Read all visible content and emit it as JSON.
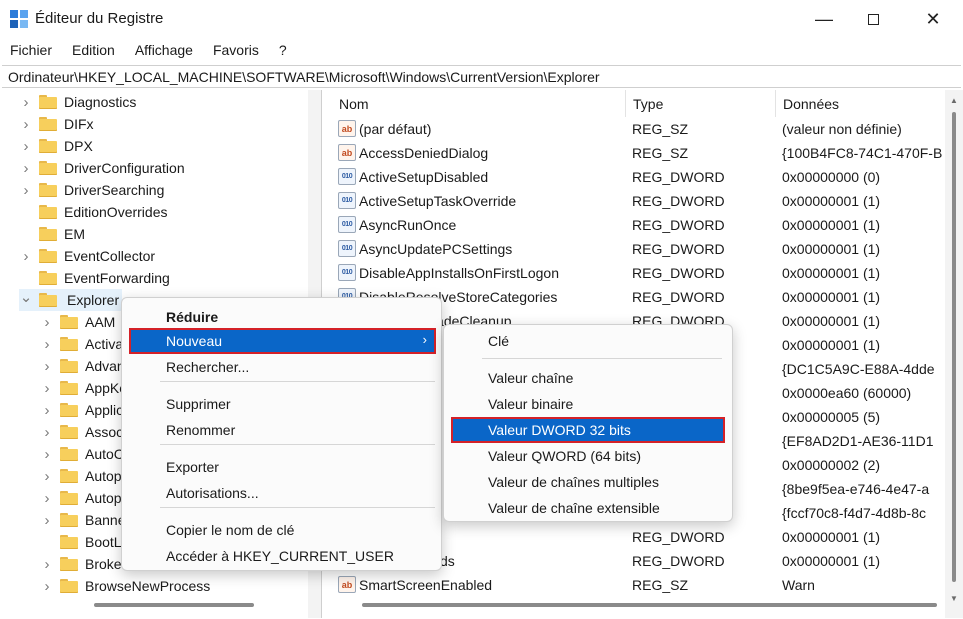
{
  "window": {
    "title": "Éditeur du Registre",
    "minimize_glyph": "—",
    "close_glyph": "✕"
  },
  "menubar": [
    "Fichier",
    "Edition",
    "Affichage",
    "Favoris",
    "?"
  ],
  "address": "Ordinateur\\HKEY_LOCAL_MACHINE\\SOFTWARE\\Microsoft\\Windows\\CurrentVersion\\Explorer",
  "tree": {
    "items": [
      {
        "label": "Diagnostics",
        "expandable": true
      },
      {
        "label": "DIFx",
        "expandable": true
      },
      {
        "label": "DPX",
        "expandable": true
      },
      {
        "label": "DriverConfiguration",
        "expandable": true
      },
      {
        "label": "DriverSearching",
        "expandable": true
      },
      {
        "label": "EditionOverrides",
        "expandable": false
      },
      {
        "label": "EM",
        "expandable": false
      },
      {
        "label": "EventCollector",
        "expandable": true
      },
      {
        "label": "EventForwarding",
        "expandable": false
      },
      {
        "label": "Explorer",
        "expandable": true,
        "expanded": true,
        "selected": true
      },
      {
        "label": "AAM",
        "expandable": true,
        "child": true
      },
      {
        "label": "Activa",
        "expandable": true,
        "child": true
      },
      {
        "label": "Advan",
        "expandable": true,
        "child": true
      },
      {
        "label": "AppKe",
        "expandable": true,
        "child": true
      },
      {
        "label": "Applic",
        "expandable": true,
        "child": true
      },
      {
        "label": "Associ",
        "expandable": true,
        "child": true
      },
      {
        "label": "AutoC",
        "expandable": true,
        "child": true
      },
      {
        "label": "Autop",
        "expandable": true,
        "child": true
      },
      {
        "label": "Autop",
        "expandable": true,
        "child": true
      },
      {
        "label": "Banne",
        "expandable": true,
        "child": true
      },
      {
        "label": "BootL",
        "expandable": false,
        "child": true
      },
      {
        "label": "Broke",
        "expandable": true,
        "child": true
      },
      {
        "label": "BrowseNewProcess",
        "expandable": true,
        "child": true
      }
    ]
  },
  "list": {
    "columns": [
      "Nom",
      "Type",
      "Données"
    ],
    "rows": [
      {
        "icon": "string-value-icon",
        "name": "(par défaut)",
        "type": "REG_SZ",
        "data": "(valeur non définie)"
      },
      {
        "icon": "string-value-icon",
        "name": "AccessDeniedDialog",
        "type": "REG_SZ",
        "data": "{100B4FC8-74C1-470F-B"
      },
      {
        "icon": "binary-value-icon",
        "name": "ActiveSetupDisabled",
        "type": "REG_DWORD",
        "data": "0x00000000 (0)"
      },
      {
        "icon": "binary-value-icon",
        "name": "ActiveSetupTaskOverride",
        "type": "REG_DWORD",
        "data": "0x00000001 (1)"
      },
      {
        "icon": "binary-value-icon",
        "name": "AsyncRunOnce",
        "type": "REG_DWORD",
        "data": "0x00000001 (1)"
      },
      {
        "icon": "binary-value-icon",
        "name": "AsyncUpdatePCSettings",
        "type": "REG_DWORD",
        "data": "0x00000001 (1)"
      },
      {
        "icon": "binary-value-icon",
        "name": "DisableAppInstallsOnFirstLogon",
        "type": "REG_DWORD",
        "data": "0x00000001 (1)"
      },
      {
        "icon": "binary-value-icon",
        "name": "DisableResolveStoreCategories",
        "type": "REG_DWORD",
        "data": "0x00000001 (1)"
      },
      {
        "icon": "binary-value-icon",
        "name": "DisableUpgradeCleanup",
        "type": "REG_DWORD",
        "data": "0x00000001 (1)"
      },
      {
        "icon": "binary-value-icon",
        "name": "",
        "type": "",
        "data": "0x00000001 (1)"
      },
      {
        "icon": "string-value-icon",
        "name": "",
        "type": "",
        "data": "{DC1C5A9C-E88A-4dde"
      },
      {
        "icon": "binary-value-icon",
        "name": "",
        "type": "",
        "data": "0x0000ea60 (60000)"
      },
      {
        "icon": "binary-value-icon",
        "name": "",
        "type": "",
        "data": "0x00000005 (5)"
      },
      {
        "icon": "string-value-icon",
        "name": "",
        "type": "",
        "data": "{EF8AD2D1-AE36-11D1"
      },
      {
        "icon": "binary-value-icon",
        "name": "",
        "type": "",
        "data": "0x00000002 (2)"
      },
      {
        "icon": "string-value-icon",
        "name": "",
        "type": "",
        "data": "{8be9f5ea-e746-4e47-a"
      },
      {
        "icon": "string-value-icon",
        "name": "",
        "type": "",
        "data": "{fccf70c8-f4d7-4d8b-8c"
      },
      {
        "icon": "binary-value-icon",
        "name": "eUpdates",
        "type": "REG_DWORD",
        "data": "0x00000001 (1)"
      },
      {
        "icon": "binary-value-icon",
        "name": "amingPayloads",
        "type": "REG_DWORD",
        "data": "0x00000001 (1)"
      },
      {
        "icon": "string-value-icon",
        "name": "SmartScreenEnabled",
        "type": "REG_SZ",
        "data": "Warn"
      }
    ]
  },
  "context_menu": {
    "items": [
      {
        "label": "Réduire",
        "bold": true
      },
      {
        "label": "Nouveau",
        "submenu": true,
        "highlighted": true
      },
      {
        "label": "Rechercher..."
      },
      {
        "label": "Supprimer"
      },
      {
        "label": "Renommer"
      },
      {
        "label": "Exporter"
      },
      {
        "label": "Autorisations..."
      },
      {
        "label": "Copier le nom de clé"
      },
      {
        "label": "Accéder à HKEY_CURRENT_USER"
      }
    ]
  },
  "submenu": {
    "items": [
      {
        "label": "Clé"
      },
      {
        "label": "Valeur chaîne"
      },
      {
        "label": "Valeur binaire"
      },
      {
        "label": "Valeur DWORD 32 bits",
        "highlighted": true
      },
      {
        "label": "Valeur QWORD (64 bits)"
      },
      {
        "label": "Valeur de chaînes multiples"
      },
      {
        "label": "Valeur de chaîne extensible"
      }
    ]
  },
  "colors": {
    "highlight": "#0a66c8",
    "highlight_border": "#d42128",
    "folder": "#f7cf5c"
  }
}
